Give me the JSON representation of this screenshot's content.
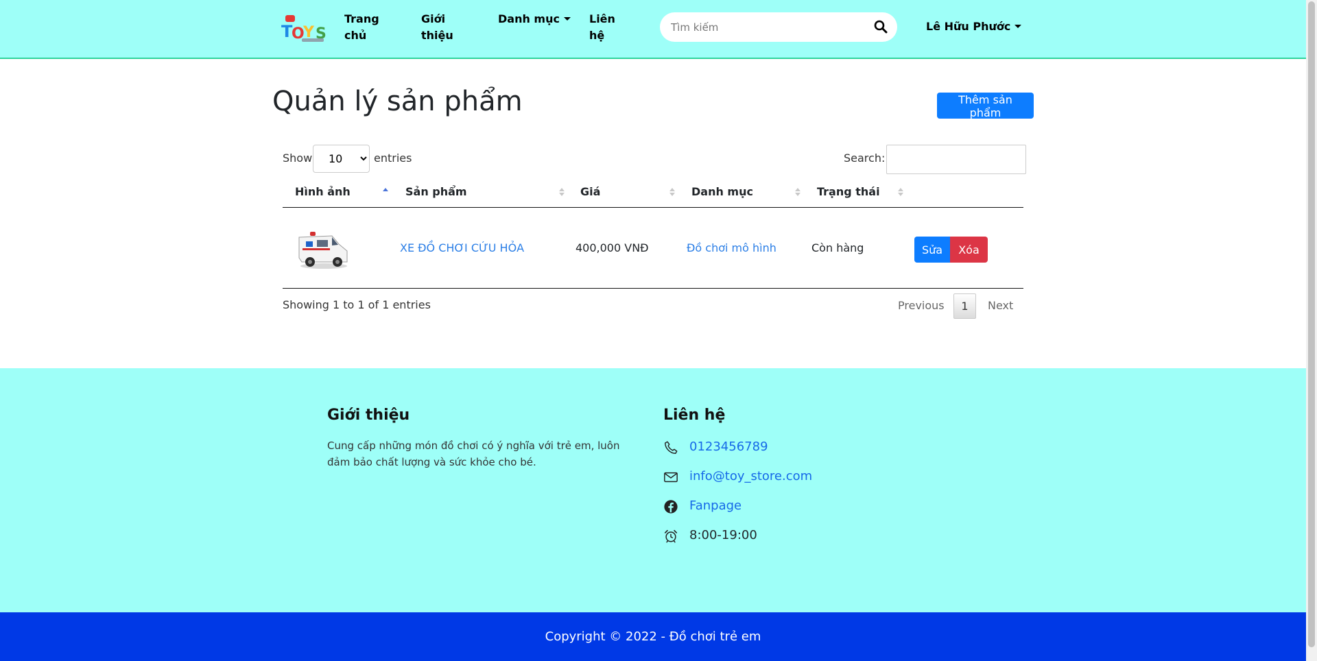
{
  "header": {
    "nav": {
      "home": [
        "Trang",
        "chủ"
      ],
      "about": [
        "Giới",
        "thiệu"
      ],
      "categories": "Danh mục",
      "contact": [
        "Liên",
        "hệ"
      ]
    },
    "search": {
      "placeholder": "Tìm kiếm"
    },
    "user_name": "Lê Hữu Phước",
    "colors": {
      "background": "#9efff8",
      "border": "#2ed39b"
    }
  },
  "main": {
    "title": "Quản lý sản phẩm",
    "add_button": "Thêm sản phẩm",
    "length_prefix": "Show",
    "length_value": "10",
    "length_options": [
      "10"
    ],
    "length_suffix": "entries",
    "search_label": "Search:",
    "columns": [
      "Hình ảnh",
      "Sản phẩm",
      "Giá",
      "Danh mục",
      "Trạng thái"
    ],
    "sorted_column": "Hình ảnh",
    "sort_direction": "asc",
    "rows": [
      {
        "image_icon": "ambulance-toy-image",
        "product": "XE ĐỒ CHƠI CỨU HỎA",
        "price": "400,000 VNĐ",
        "category": "Đồ chơi mô hình",
        "status": "Còn hàng",
        "edit": "Sửa",
        "delete": "Xóa"
      }
    ],
    "info": "Showing 1 to 1 of 1 entries",
    "pagination": {
      "previous": "Previous",
      "current": "1",
      "next": "Next"
    },
    "colors": {
      "primary": "#0d7dff",
      "danger": "#dc3545",
      "link": "#2a7ee6"
    }
  },
  "footer": {
    "about": {
      "title": "Giới thiệu",
      "text": "Cung cấp những món đồ chơi có ý nghĩa với trẻ em, luôn đảm bảo chất lượng và sức khỏe cho bé."
    },
    "contact": {
      "title": "Liên hệ",
      "items": [
        {
          "icon": "phone-icon",
          "text": "0123456789"
        },
        {
          "icon": "envelope-icon",
          "text": "info@toy_store.com"
        },
        {
          "icon": "facebook-icon",
          "text": "Fanpage"
        },
        {
          "icon": "alarm-clock-icon",
          "text": "8:00-19:00"
        }
      ]
    },
    "copyright": "Copyright © 2022 - Đồ chơi trẻ em",
    "colors": {
      "background": "#9efff8",
      "copyright_bg": "#0039e6"
    }
  }
}
